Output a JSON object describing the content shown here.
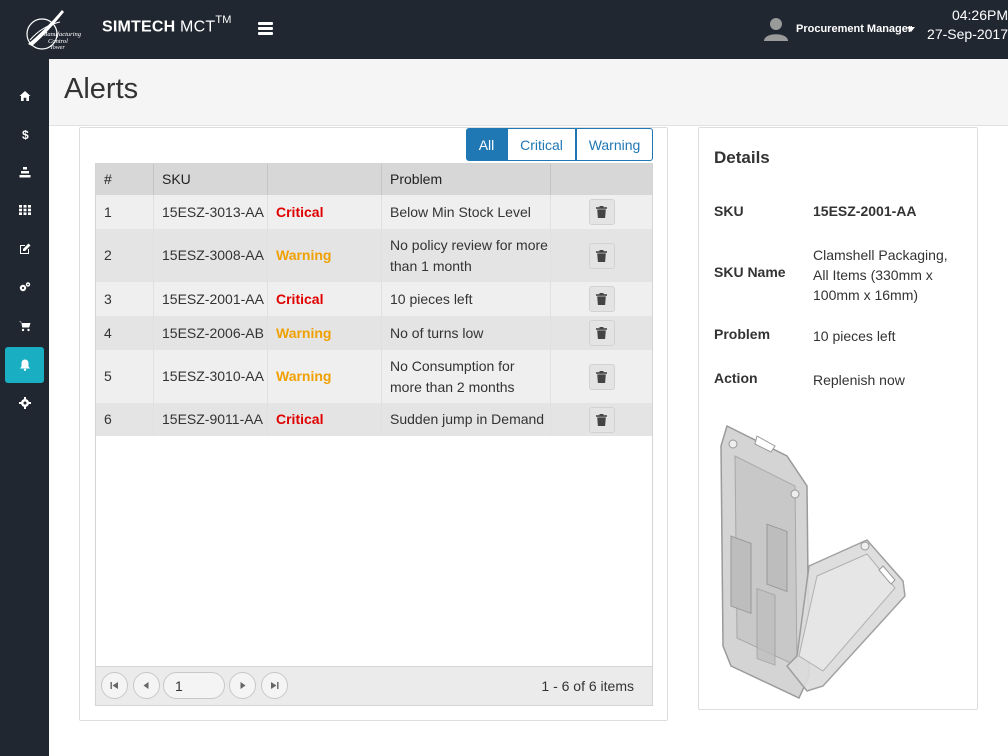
{
  "header": {
    "brand_bold": "SIMTECH",
    "brand_rest": " MCT",
    "brand_sup": "TM",
    "user_name": "Procurement Manager",
    "time": "04:26PM",
    "date": "27-Sep-2017"
  },
  "sidebar": {
    "items": [
      {
        "name": "home-icon"
      },
      {
        "name": "dollar-icon"
      },
      {
        "name": "stack-icon"
      },
      {
        "name": "grid-icon"
      },
      {
        "name": "edit-icon"
      },
      {
        "name": "cogs-icon"
      },
      {
        "name": "cart-icon"
      },
      {
        "name": "bell-icon",
        "active": true
      },
      {
        "name": "gear-icon"
      }
    ],
    "accent": "#1aaec3"
  },
  "page": {
    "title": "Alerts"
  },
  "filters": {
    "all": "All",
    "critical": "Critical",
    "warning": "Warning",
    "selected": "All"
  },
  "table": {
    "columns": [
      "#",
      "SKU",
      "",
      "Problem",
      ""
    ],
    "rows": [
      {
        "num": "1",
        "sku": "15ESZ-3013-AA",
        "level": "Critical",
        "problem": "Below Min Stock Level"
      },
      {
        "num": "2",
        "sku": "15ESZ-3008-AA",
        "level": "Warning",
        "problem": "No policy review for more than 1 month"
      },
      {
        "num": "3",
        "sku": "15ESZ-2001-AA",
        "level": "Critical",
        "problem": "10 pieces left"
      },
      {
        "num": "4",
        "sku": "15ESZ-2006-AB",
        "level": "Warning",
        "problem": "No of turns low"
      },
      {
        "num": "5",
        "sku": "15ESZ-3010-AA",
        "level": "Warning",
        "problem": "No Consumption for more than 2 months"
      },
      {
        "num": "6",
        "sku": "15ESZ-9011-AA",
        "level": "Critical",
        "problem": "Sudden jump in Demand"
      }
    ],
    "colors": {
      "critical": "#e00000",
      "warning": "#f0a000"
    }
  },
  "pager": {
    "page_value": "1",
    "info": "1 - 6 of 6 items"
  },
  "details": {
    "title": "Details",
    "sku_label": "SKU",
    "sku_value": "15ESZ-2001-AA",
    "name_label": "SKU Name",
    "name_value": "Clamshell Packaging, All Items (330mm x 100mm x 16mm)",
    "problem_label": "Problem",
    "problem_value": "10 pieces left",
    "action_label": "Action",
    "action_value": "Replenish now"
  }
}
